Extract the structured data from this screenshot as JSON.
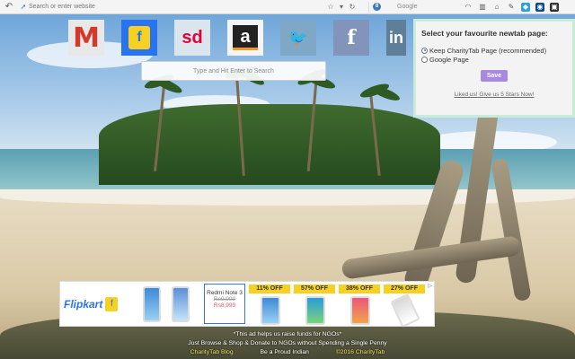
{
  "toolbar": {
    "url_placeholder": "Search or enter website",
    "search_engine": "Google",
    "nav_back": "↶",
    "star": "☆",
    "dropdown": "▾",
    "refresh": "↻"
  },
  "shortcuts": [
    {
      "name": "Gmail",
      "glyph": "M"
    },
    {
      "name": "Flipkart",
      "glyph": "f"
    },
    {
      "name": "Snapdeal",
      "glyph": "sd"
    },
    {
      "name": "Amazon",
      "glyph": "a"
    },
    {
      "name": "Twitter",
      "glyph": "🐦"
    },
    {
      "name": "Facebook",
      "glyph": "f"
    },
    {
      "name": "LinkedIn",
      "glyph": "in"
    }
  ],
  "search": {
    "placeholder": "Type and Hit Enter to Search"
  },
  "settings_panel": {
    "title": "Select your favourite newtab page:",
    "options": [
      {
        "label": "Keep CharityTab Page (recommended)",
        "selected": true
      },
      {
        "label": "Google Page",
        "selected": false
      }
    ],
    "save_label": "Save",
    "liked_link": "Liked us! Give us 5 Stars Now!"
  },
  "ad": {
    "brand": "Flipkart",
    "adchoices": "▷",
    "featured": {
      "name": "Redmi Note 3",
      "old_price": "Rs9,999",
      "price": "Rs8,999"
    },
    "discounts": [
      "11% OFF",
      "57% OFF",
      "38% OFF",
      "27% OFF"
    ]
  },
  "footer": {
    "line1": "*This ad helps us raise funds for NGOs*",
    "line2": "Just Browse & Shop & Donate to NGOs without Spending a Single Penny",
    "link_blog": "CharityTab Blog",
    "tagline": "Be a Proud Indian",
    "copyright": "©2016 CharityTab"
  },
  "colors": {
    "panel_border": "#c9ecd9",
    "save_button": "#a889e0",
    "flipkart_blue": "#2874f0",
    "flipkart_yellow": "#f7d020",
    "footer_link": "#e8e25a"
  }
}
